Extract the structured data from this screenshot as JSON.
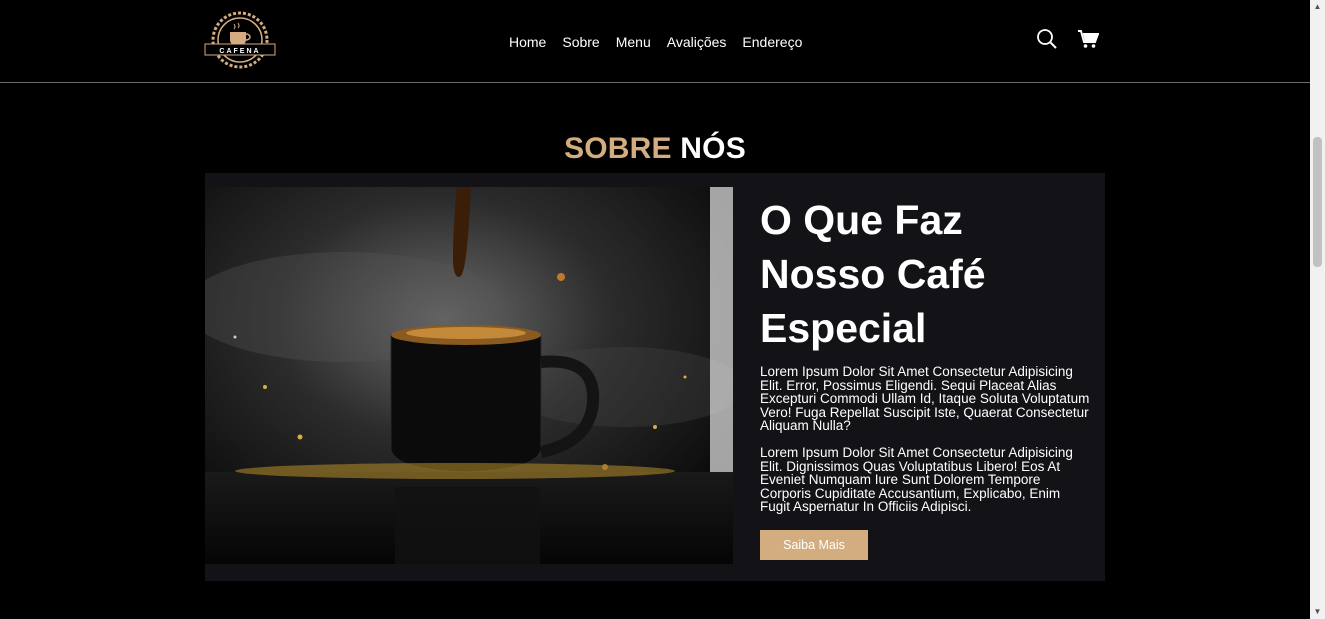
{
  "header": {
    "logo_text": "CAFENA",
    "nav": [
      "Home",
      "Sobre",
      "Menu",
      "Avalições",
      "Endereço"
    ],
    "icons": [
      "search-icon",
      "cart-icon"
    ]
  },
  "section": {
    "title_accent": "SOBRE",
    "title_main": "NÓS"
  },
  "about": {
    "heading": "O Que Faz Nosso Café Especial",
    "paragraph_1": "Lorem Ipsum Dolor Sit Amet Consectetur Adipisicing Elit. Error, Possimus Eligendi. Sequi Placeat Alias Excepturi Commodi Ullam Id, Itaque Soluta Voluptatum Vero! Fuga Repellat Suscipit Iste, Quaerat Consectetur Aliquam Nulla?",
    "paragraph_2": "Lorem Ipsum Dolor Sit Amet Consectetur Adipisicing Elit. Dignissimos Quas Voluptatibus Libero! Eos At Eveniet Numquam Iure Sunt Dolorem Tempore Corporis Cupiditate Accusantium, Explicabo, Enim Fugit Aspernatur In Officiis Adipisci.",
    "button_label": "Saiba Mais"
  },
  "colors": {
    "accent": "#d3ad7f",
    "background": "#000000",
    "card": "#131317"
  }
}
